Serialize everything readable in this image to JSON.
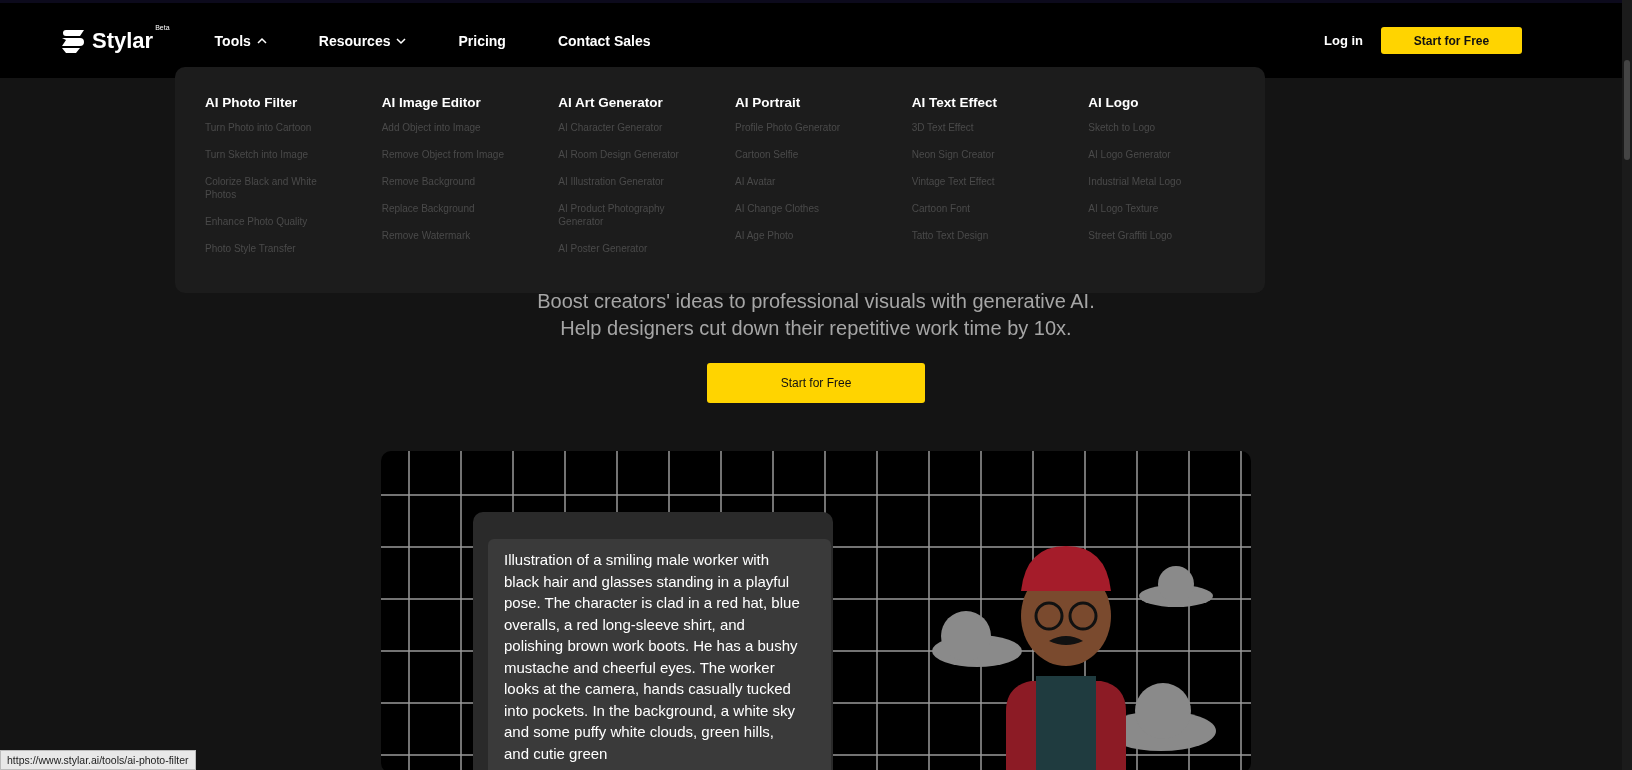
{
  "header": {
    "logo": {
      "name": "Stylar",
      "badge": "Beta"
    },
    "nav": [
      {
        "label": "Tools",
        "kind": "dropdown",
        "expanded": true
      },
      {
        "label": "Resources",
        "kind": "dropdown",
        "expanded": false
      },
      {
        "label": "Pricing",
        "kind": "link"
      },
      {
        "label": "Contact Sales",
        "kind": "link"
      }
    ],
    "login": "Log in",
    "cta": "Start for Free"
  },
  "tools_menu": {
    "columns": [
      {
        "title": "AI Photo Filter",
        "items": [
          "Turn Photo into Cartoon",
          "Turn Sketch into Image",
          "Colorize Black and White Photos",
          "Enhance Photo Quality",
          "Photo Style Transfer"
        ]
      },
      {
        "title": "AI Image Editor",
        "items": [
          "Add Object into Image",
          "Remove Object from Image",
          "Remove Background",
          "Replace Background",
          "Remove Watermark"
        ]
      },
      {
        "title": "AI Art Generator",
        "items": [
          "AI Character Generator",
          "AI Room Design Generator",
          "AI Illustration Generator",
          "AI Product Photography Generator",
          "AI Poster Generator"
        ]
      },
      {
        "title": "AI Portrait",
        "items": [
          "Profile Photo Generator",
          "Cartoon Selfie",
          "AI Avatar",
          "AI Change Clothes",
          "AI Age Photo"
        ]
      },
      {
        "title": "AI Text Effect",
        "items": [
          "3D Text Effect",
          "Neon Sign Creator",
          "Vintage Text Effect",
          "Cartoon Font",
          "Tatto Text Design"
        ]
      },
      {
        "title": "AI Logo",
        "items": [
          "Sketch to Logo",
          "AI Logo Generator",
          "Industrial Metal Logo",
          "AI Logo Texture",
          "Street Graffiti Logo"
        ]
      }
    ]
  },
  "hero": {
    "subtitle": [
      "Boost creators' ideas to professional visuals with generative AI.",
      "Help designers cut down their repetitive work time by 10x."
    ],
    "cta": "Start for Free",
    "demo": {
      "prompt": "Illustration of a smiling male worker with black hair and glasses standing in a playful pose. The character is clad in a red hat, blue overalls, a red long-sleeve shirt, and polishing brown work boots. He has a bushy mustache and cheerful eyes. The worker looks at the camera, hands casually tucked into pockets. In the background, a white sky and some puffy white clouds, green hills, and cutie green"
    }
  },
  "status_url": "https://www.stylar.ai/tools/ai-photo-filter"
}
